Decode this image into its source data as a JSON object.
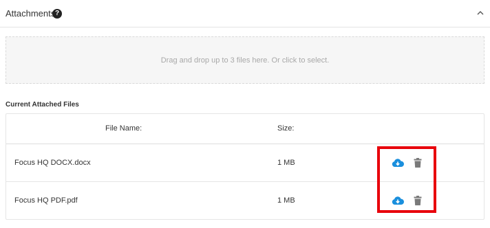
{
  "header": {
    "title": "Attachments",
    "help_icon_glyph": "?",
    "help_icon": "question-circle-icon",
    "collapse_icon": "chevron-up-icon"
  },
  "dropzone": {
    "text": "Drag and drop up to 3 files here. Or click to select."
  },
  "files": {
    "section_title": "Current Attached Files",
    "columns": {
      "name": "File Name:",
      "size": "Size:"
    },
    "rows": [
      {
        "name": "Focus HQ DOCX.docx",
        "size": "1 MB",
        "actions": [
          "cloud-download-icon",
          "trash-icon"
        ]
      },
      {
        "name": "Focus HQ PDF.pdf",
        "size": "1 MB",
        "actions": [
          "cloud-download-icon",
          "trash-icon"
        ]
      }
    ]
  },
  "colors": {
    "download_icon": "#1a8fdd",
    "delete_icon": "#7a7a7a",
    "highlight_box": "#e8000b"
  }
}
